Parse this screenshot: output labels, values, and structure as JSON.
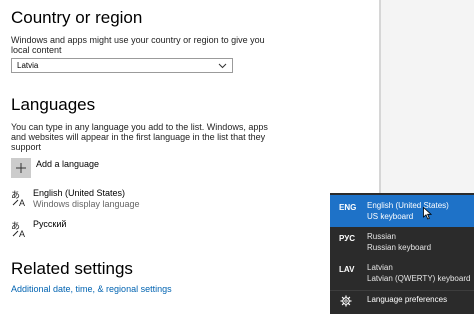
{
  "country": {
    "heading": "Country or region",
    "description_line1": "Windows and apps might use your country or region to give you",
    "description_line2": "local content",
    "selected_value": "Latvia"
  },
  "languages": {
    "heading": "Languages",
    "description_line1": "You can type in any language you add to the list. Windows, apps",
    "description_line2": "and websites will appear in the first language in the list that they",
    "description_line3": "support",
    "add_label": "Add a language",
    "items": [
      {
        "name": "English (United States)",
        "sub": "Windows display language",
        "icon": "language-icon"
      },
      {
        "name": "Русский",
        "sub": "",
        "icon": "language-icon"
      }
    ]
  },
  "related": {
    "heading": "Related settings",
    "link": "Additional date, time, & regional settings"
  },
  "flyout": {
    "items": [
      {
        "code": "ENG",
        "name": "English (United States)",
        "keyboard": "US keyboard",
        "active": true
      },
      {
        "code": "РУС",
        "name": "Russian",
        "keyboard": "Russian keyboard",
        "active": false
      },
      {
        "code": "LAV",
        "name": "Latvian",
        "keyboard": "Latvian (QWERTY) keyboard",
        "active": false
      }
    ],
    "preferences_label": "Language preferences",
    "preferences_icon": "gear-icon"
  },
  "colors": {
    "accent": "#1e72c8",
    "flyout_bg": "#2b2b2b",
    "link": "#0063b1"
  }
}
